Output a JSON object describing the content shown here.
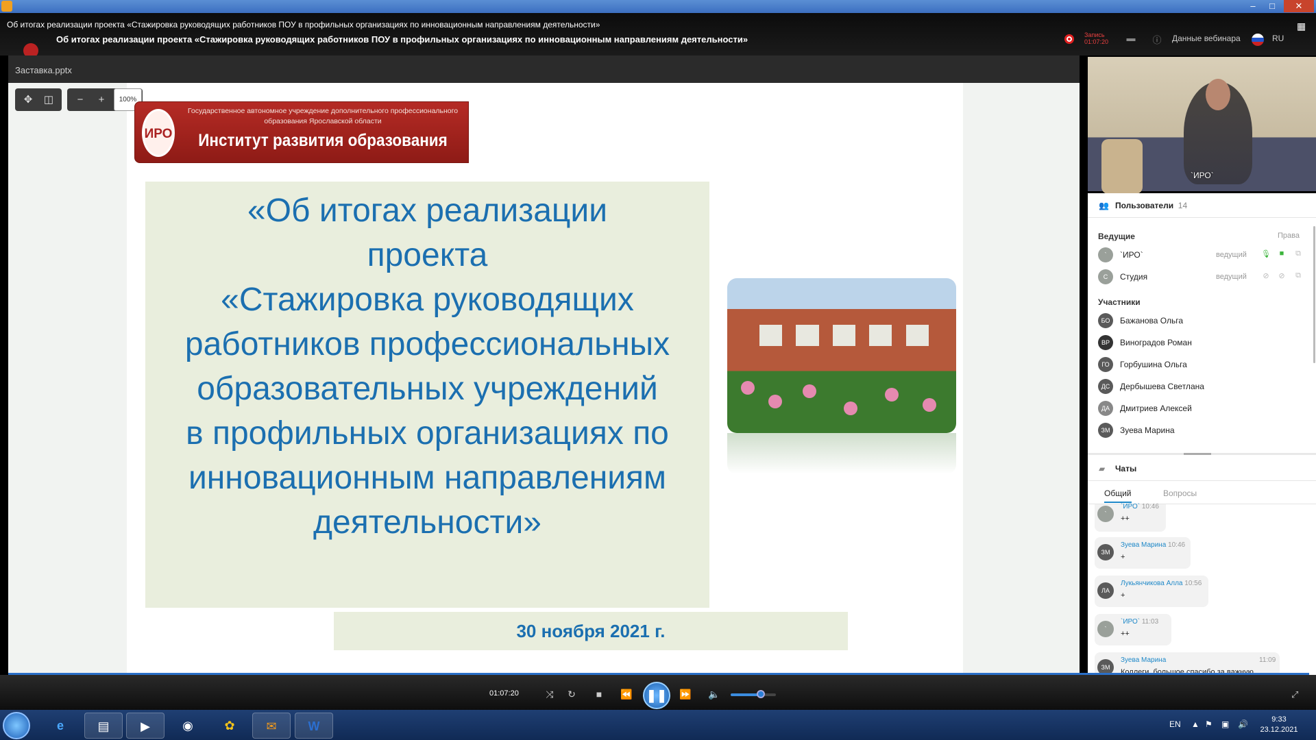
{
  "window": {
    "title": "Об итогах реализации проекта «Стажировка руководящих работников ПОУ в профильных организациях по инновационным направлениям деятельности»",
    "minimize": "–",
    "maximize": "□",
    "close": "✕"
  },
  "webinar": {
    "title": "Об итогах реализации проекта «Стажировка руководящих работников ПОУ в профильных организациях по инновационным направлениям деятельности»",
    "record_label": "Запись",
    "record_time": "01:07:20",
    "webinar_info": "Данные вебинара",
    "language": "RU"
  },
  "presentation": {
    "file_name": "Заставка.pptx",
    "zoom": "100%",
    "zoom_out": "−",
    "zoom_in": "+",
    "slide": {
      "org_line": "Государственное автономное учреждение дополнительного профессионального образования Ярославской области",
      "institute": "Институт развития образования",
      "emblem": "ИРО",
      "main_text": "«Об итогах реализации\nпроекта\n«Стажировка руководящих\nработников профессиональных\nобразовательных учреждений\nв профильных организациях по\nинновационным направлениям\nдеятельности»",
      "date": "30 ноября 2021 г."
    }
  },
  "camera": {
    "label": "`ИРО`"
  },
  "users": {
    "title": "Пользователи",
    "count": "14",
    "hosts_label": "Ведущие",
    "rights_label": "Права",
    "hosts": [
      {
        "initials": "`",
        "name": "`ИРО`",
        "role": "ведущий"
      },
      {
        "initials": "С",
        "name": "Студия",
        "role": "ведущий"
      }
    ],
    "participants_label": "Участники",
    "participants": [
      {
        "initials": "БО",
        "name": "Бажанова Ольга"
      },
      {
        "initials": "ВР",
        "name": "Виноградов Роман"
      },
      {
        "initials": "ГО",
        "name": "Горбушина Ольга"
      },
      {
        "initials": "ДС",
        "name": "Дербышева Светлана"
      },
      {
        "initials": "ДА",
        "name": "Дмитриев Алексей"
      },
      {
        "initials": "ЗМ",
        "name": "Зуева Марина"
      }
    ]
  },
  "chats": {
    "title": "Чаты",
    "tabs": [
      "Общий",
      "Вопросы"
    ],
    "messages": [
      {
        "initials": "`",
        "author": "`ИРО`",
        "time": "10:46",
        "text": "++"
      },
      {
        "initials": "ЗМ",
        "author": "Зуева Марина",
        "time": "10:46",
        "text": "+"
      },
      {
        "initials": "ЛА",
        "author": "Лукьянчикова Алла",
        "time": "10:56",
        "text": "+"
      },
      {
        "initials": "`",
        "author": "`ИРО`",
        "time": "11:03",
        "text": "++"
      },
      {
        "initials": "ЗМ",
        "author": "Зуева Марина",
        "time": "11:09",
        "text": "Коллеги, большое спасибо за важную работу! Хорошая практика работы всегда востребована!"
      }
    ]
  },
  "player": {
    "time": "01:07:20"
  },
  "taskbar": {
    "lang": "EN",
    "time": "9:33",
    "date": "23.12.2021"
  },
  "colors": {
    "accent": "#1e88c8",
    "slide_text": "#1b6fb0",
    "banner": "#a0231d",
    "record": "#e02020"
  }
}
